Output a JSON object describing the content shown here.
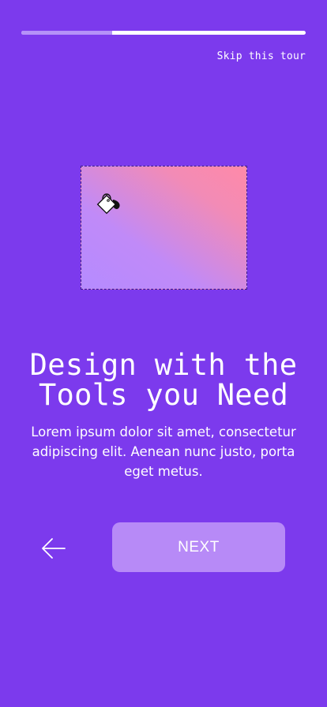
{
  "onboarding": {
    "progress": 0.32,
    "skip_label": "Skip this tour",
    "heading_line1": "Design with the",
    "heading_line2": "Tools you Need",
    "body": "Lorem ipsum dolor sit amet, consectetur adipiscing elit. Aenean nunc justo, porta eget metus.",
    "next_label": "NEXT",
    "back_icon": "arrow-left-icon",
    "illustration_icon": "paint-bucket-icon"
  },
  "colors": {
    "background": "#7c3aed",
    "progress_track": "#ffffff",
    "progress_fill": "#b592f8",
    "next_button": "#b78af7",
    "gradient_start": "#b58bff",
    "gradient_end": "#ff8aa8"
  }
}
